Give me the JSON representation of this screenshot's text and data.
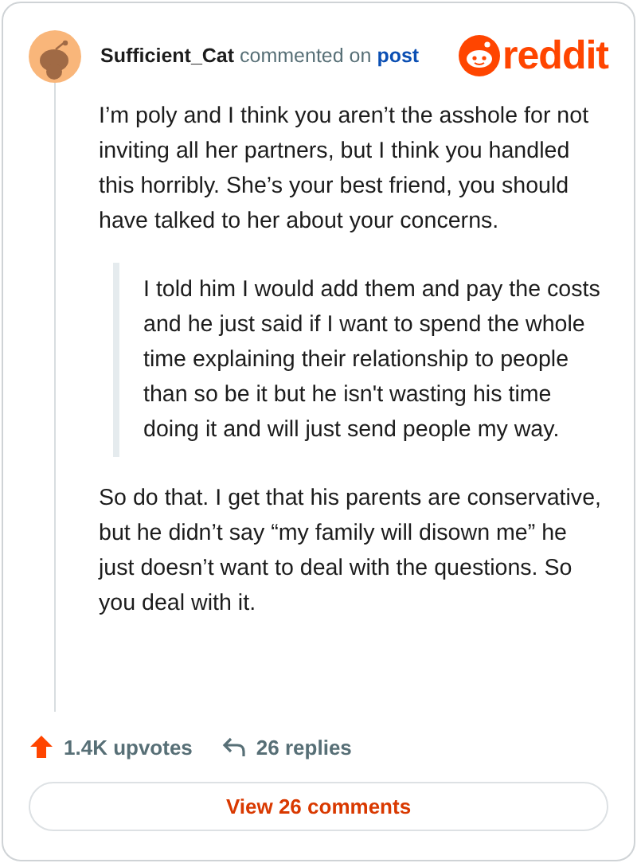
{
  "header": {
    "username": "Sufficient_Cat",
    "action": "commented on",
    "link": "post",
    "brand": "reddit"
  },
  "body": [
    {
      "kind": "paragraph",
      "text": "I’m poly and I think you aren’t the asshole for not inviting all her partners, but I think you handled this horribly. She’s your best friend, you should have talked to her about your concerns."
    },
    {
      "kind": "quote",
      "text": "I told him I would add them and pay the costs and he just said if I want to spend the whole time explaining their relationship to people than so be it but he isn't wasting his time doing it and will just send people my way."
    },
    {
      "kind": "paragraph",
      "text": "So do that. I get that his parents are conservative, but he didn’t say “my family will disown me” he just doesn’t want to deal with the questions. So you deal with it."
    }
  ],
  "footer": {
    "upvotes": "1.4K upvotes",
    "replies": "26 replies"
  },
  "button": "View 26 comments"
}
